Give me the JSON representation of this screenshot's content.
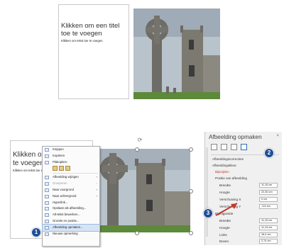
{
  "top_slide": {
    "title": "Klikken om een titel toe te voegen",
    "body": "Klikken om tekst toe te voegen"
  },
  "bottom_slide": {
    "title": "Klikken om een titel toe te voegen",
    "body": "Klikken om tekst toe te voegen"
  },
  "context_menu": {
    "items": [
      {
        "label": "Knippen",
        "icon": "scissors-icon"
      },
      {
        "label": "Kopiëren",
        "icon": "copy-icon"
      },
      {
        "label": "Plakopties:",
        "icon": "paste-icon"
      },
      {
        "label": "Afbeelding wijzigen",
        "icon": "picture-icon",
        "submenu": true
      },
      {
        "label": "Groeperen",
        "icon": "group-icon",
        "submenu": true,
        "disabled": true
      },
      {
        "label": "Naar voorgrond",
        "icon": "bring-forward-icon",
        "submenu": true
      },
      {
        "label": "Naar achtergrond",
        "icon": "send-backward-icon",
        "submenu": true
      },
      {
        "label": "Hyperlink...",
        "icon": "link-icon"
      },
      {
        "label": "Opslaan als afbeelding...",
        "icon": "save-image-icon"
      },
      {
        "label": "Alt-tekst bewerken...",
        "icon": "alt-text-icon"
      },
      {
        "label": "Grootte en positie...",
        "icon": "size-position-icon"
      },
      {
        "label": "Afbeelding opmaken...",
        "icon": "format-picture-icon",
        "highlighted": true
      },
      {
        "label": "Nieuwe opmerking",
        "icon": "comment-icon"
      }
    ]
  },
  "format_pane": {
    "title": "Afbeelding opmaken",
    "close": "×",
    "sections": {
      "corrections": "Afbeeldingscorrecties",
      "color": "Afbeeldingskleur",
      "crop": "Bijsnijden",
      "picture_position": "Positie van afbeelding",
      "crop_position": "Bijsnijpositie"
    },
    "picture_fields": [
      {
        "label": "Breedte",
        "value": "11,15 cm"
      },
      {
        "label": "Hoogte",
        "value": "22,30 cm"
      },
      {
        "label": "Verschuiving X",
        "value": "0 cm"
      },
      {
        "label": "Verschuiving Y",
        "value": "-3,6 cm"
      }
    ],
    "crop_fields": [
      {
        "label": "Breedte",
        "value": "11,15 cm"
      },
      {
        "label": "Hoogte",
        "value": "11,13 cm"
      },
      {
        "label": "Links",
        "value": "16,4 cm"
      },
      {
        "label": "Boven",
        "value": "2,74 cm"
      }
    ]
  },
  "callouts": [
    "1",
    "2",
    "3"
  ],
  "colors": {
    "callout": "#1f4e9a",
    "highlight_arrow": "#c0392b",
    "selected_tab": "#2f6fb8"
  }
}
